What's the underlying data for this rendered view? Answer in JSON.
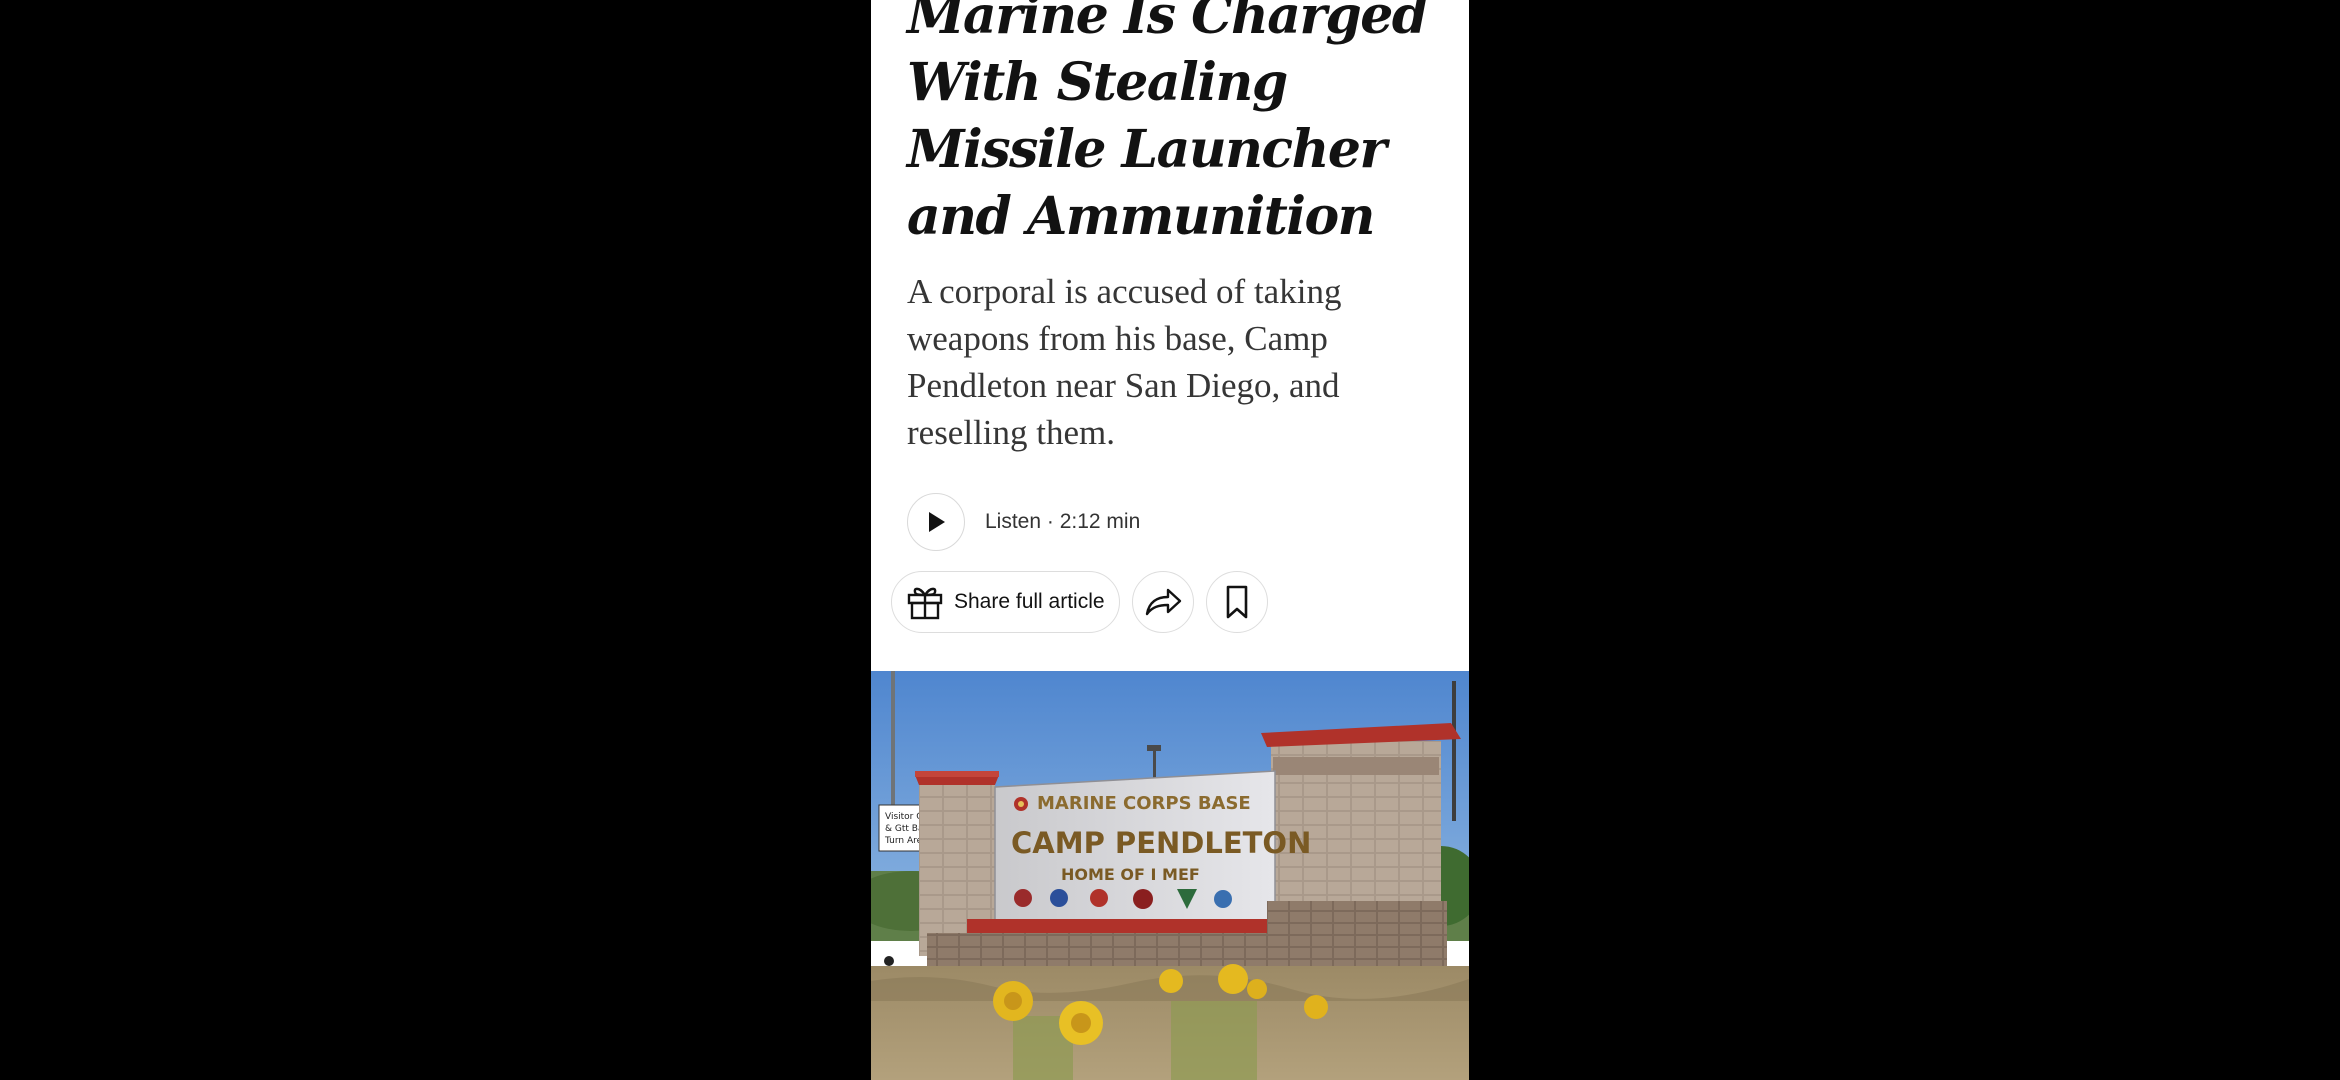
{
  "article": {
    "headline": "Marine Is Charged With Stealing Missile Launcher and Ammunition",
    "summary": "A corporal is accused of taking weapons from his base, Camp Pendleton near San Diego, and reselling them.",
    "listen": {
      "label": "Listen · 2:12 min",
      "play_icon": "play-icon"
    },
    "actions": {
      "share_full_article": "Share full article",
      "gift_icon": "gift-icon",
      "share_icon": "share-arrow-icon",
      "bookmark_icon": "bookmark-icon"
    },
    "photo": {
      "sign_line1": "MARINE CORPS BASE",
      "sign_line2": "CAMP PENDLETON",
      "sign_line3": "HOME OF I MEF",
      "side_sign": [
        "Visitor C",
        "& Gtt Ba",
        "Turn Are"
      ]
    }
  },
  "colors": {
    "page_background": "#000000",
    "article_background": "#ffffff",
    "headline_text": "#121212",
    "summary_text": "#363636",
    "sky": "#5b8fd0",
    "brick_red": "#b0322a"
  }
}
